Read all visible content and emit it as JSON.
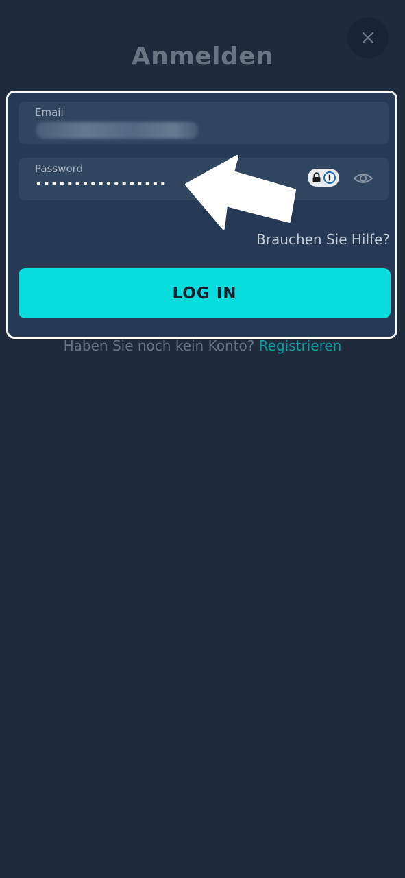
{
  "header": {
    "title": "Anmelden",
    "close_icon": "close-icon"
  },
  "form": {
    "email": {
      "label": "Email",
      "value_obscured": true
    },
    "password": {
      "label": "Password",
      "value": "•••••••••••••••••",
      "password_manager_icon": "password-manager-icon",
      "toggle_icon": "eye-icon"
    },
    "help_link": "Brauchen Sie Hilfe?",
    "login_label": "LOG IN"
  },
  "footer": {
    "prompt": "Haben Sie noch kein Konto?",
    "register_link": "Registrieren"
  },
  "colors": {
    "background": "#1f2b3b",
    "card": "#263a55",
    "field": "#30465f",
    "accent": "#08dcdc",
    "link": "#0c9a9e"
  }
}
